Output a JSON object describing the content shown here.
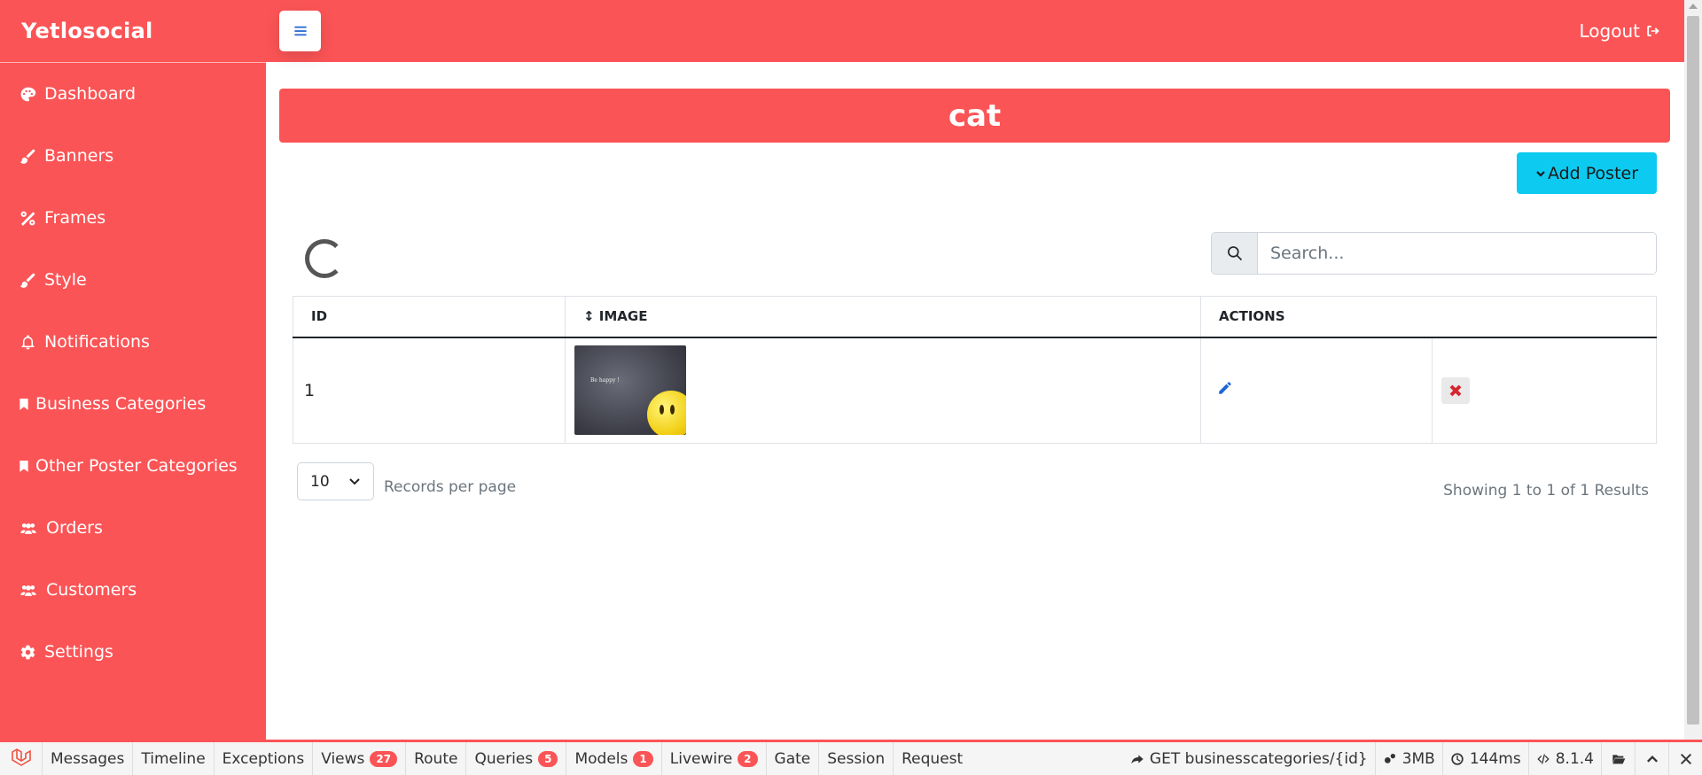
{
  "app": {
    "brand": "Yetlosocial"
  },
  "sidebar": {
    "items": [
      {
        "label": "Dashboard",
        "icon": "palette-icon"
      },
      {
        "label": "Banners",
        "icon": "brush-icon"
      },
      {
        "label": "Frames",
        "icon": "percent-icon"
      },
      {
        "label": "Style",
        "icon": "brush-icon"
      },
      {
        "label": "Notifications",
        "icon": "bell-icon"
      },
      {
        "label": "Business Categories",
        "icon": "bookmark-icon"
      },
      {
        "label": "Other Poster Categories",
        "icon": "bookmark-icon"
      },
      {
        "label": "Orders",
        "icon": "users-icon"
      },
      {
        "label": "Customers",
        "icon": "users-icon"
      },
      {
        "label": "Settings",
        "icon": "gear-icon"
      }
    ]
  },
  "topbar": {
    "logout_label": "Logout"
  },
  "page": {
    "title": "cat",
    "add_button": "Add Poster",
    "search_placeholder": "Search..."
  },
  "table": {
    "headers": {
      "id": "ID",
      "image": "↕ IMAGE",
      "actions": "ACTIONS"
    },
    "rows": [
      {
        "id": "1",
        "image_text": "Be happy !"
      }
    ]
  },
  "pagination": {
    "per_page": "10",
    "per_page_label": "Records per page",
    "showing": "Showing 1 to 1 of 1 Results"
  },
  "debugbar": {
    "tabs": [
      {
        "label": "Messages",
        "badge": ""
      },
      {
        "label": "Timeline",
        "badge": ""
      },
      {
        "label": "Exceptions",
        "badge": ""
      },
      {
        "label": "Views",
        "badge": "27"
      },
      {
        "label": "Route",
        "badge": ""
      },
      {
        "label": "Queries",
        "badge": "5"
      },
      {
        "label": "Models",
        "badge": "1"
      },
      {
        "label": "Livewire",
        "badge": "2"
      },
      {
        "label": "Gate",
        "badge": ""
      },
      {
        "label": "Session",
        "badge": ""
      },
      {
        "label": "Request",
        "badge": ""
      }
    ],
    "route": "GET businesscategories/{id}",
    "memory": "3MB",
    "time": "144ms",
    "php_version": "8.1.4"
  },
  "colors": {
    "primary": "#fb5456",
    "info": "#0dcaf0",
    "edit": "#1e66d6",
    "delete": "#d6252e"
  }
}
